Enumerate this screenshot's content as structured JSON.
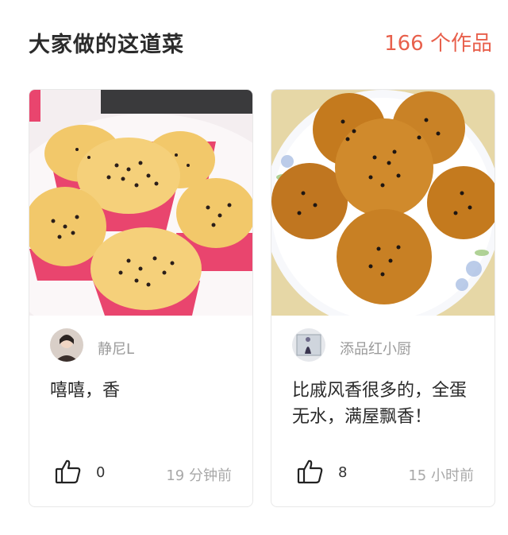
{
  "header": {
    "title": "大家做的这道菜",
    "count": "166 个作品"
  },
  "cards": [
    {
      "author": "静尼L",
      "description": "嘻嘻，香",
      "likes": "0",
      "time": "19 分钟前"
    },
    {
      "author": "添品红小厨",
      "description": "比戚风香很多的，全蛋无水，满屋飘香！",
      "likes": "8",
      "time": "15 小时前"
    }
  ],
  "colors": {
    "accent": "#e8604c",
    "cupcake_liner": "#e9456e",
    "cake_crumb": "#f2c25e",
    "cake_dark": "#c47a1e"
  },
  "icons": {
    "like": "thumbs-up-icon"
  }
}
